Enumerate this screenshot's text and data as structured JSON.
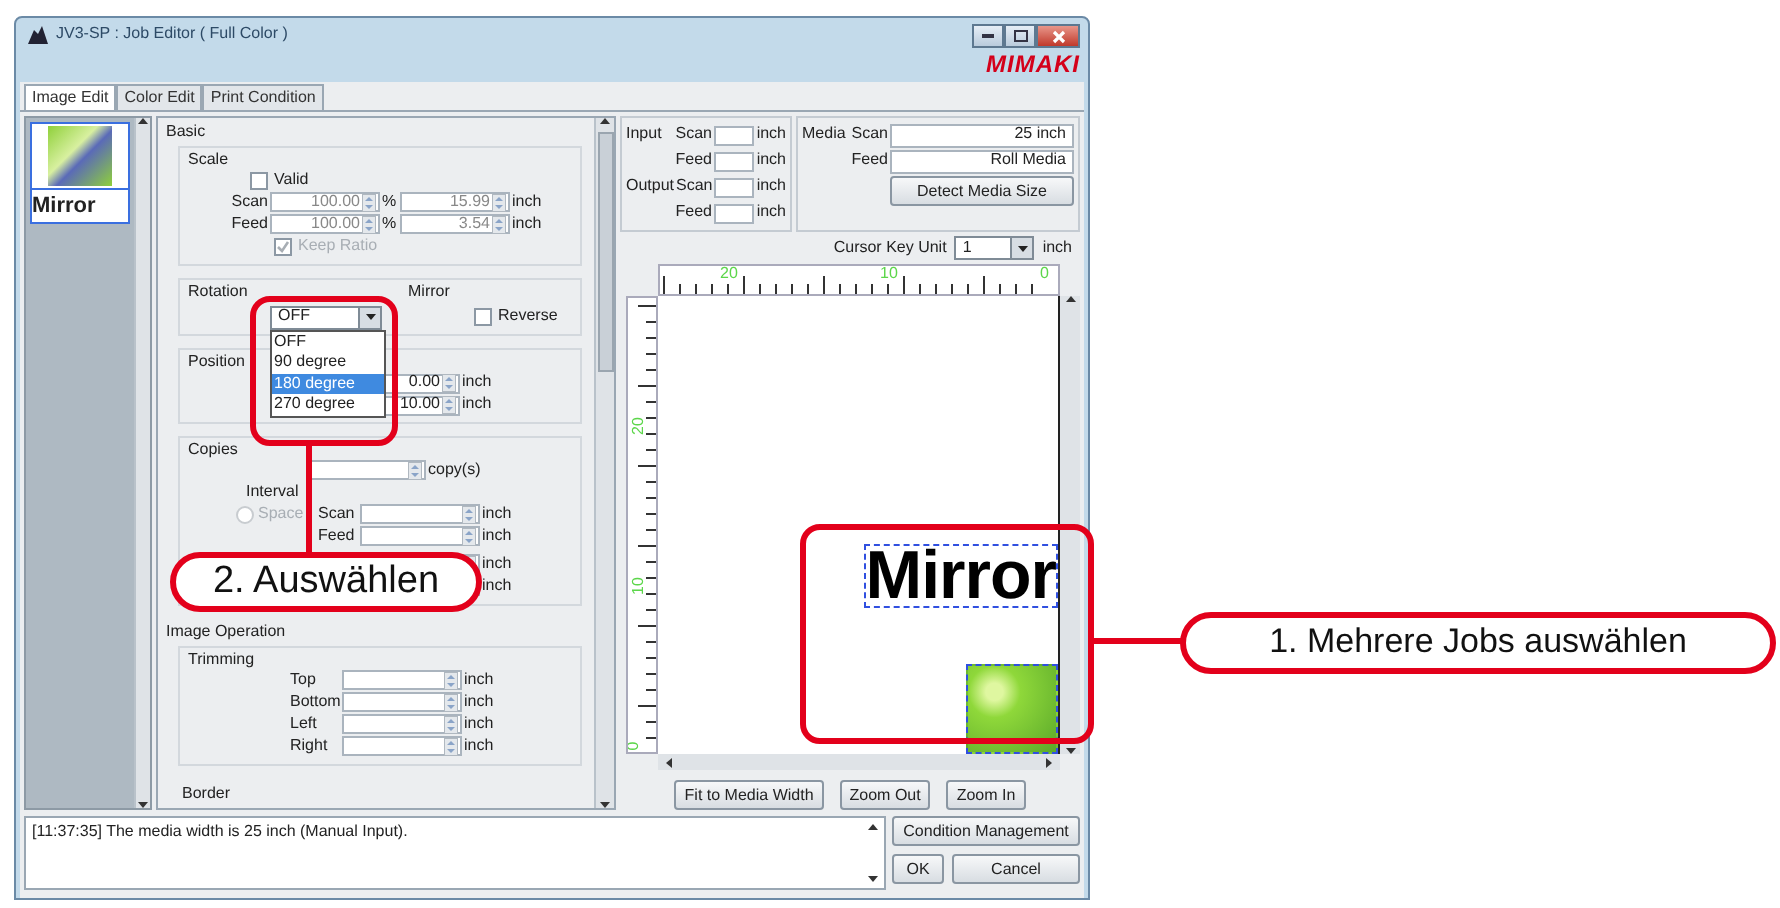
{
  "window": {
    "title": "JV3-SP : Job Editor ( Full Color )",
    "logo": "MIMAKI"
  },
  "tabs": [
    {
      "label": "Image Edit",
      "selected": true
    },
    {
      "label": "Color Edit",
      "selected": false
    },
    {
      "label": "Print Condition",
      "selected": false
    }
  ],
  "job_list": [
    {
      "caption": "Mirror",
      "selected": true
    }
  ],
  "basic": {
    "title": "Basic",
    "scale": {
      "title": "Scale",
      "valid": {
        "label": "Valid",
        "checked": false
      },
      "rows": [
        {
          "label": "Scan",
          "percent": "100.00",
          "percent_unit": "%",
          "length": "15.99",
          "unit": "inch"
        },
        {
          "label": "Feed",
          "percent": "100.00",
          "percent_unit": "%",
          "length": "3.54",
          "unit": "inch"
        }
      ],
      "keep_ratio": {
        "label": "Keep Ratio",
        "checked": true,
        "disabled": true
      }
    },
    "rotation": {
      "title": "Rotation",
      "value": "OFF",
      "options": [
        {
          "label": "OFF",
          "highlighted": false
        },
        {
          "label": "90 degree",
          "highlighted": false
        },
        {
          "label": "180 degree",
          "highlighted": true
        },
        {
          "label": "270 degree",
          "highlighted": false
        }
      ]
    },
    "mirror": {
      "title": "Mirror",
      "reverse": {
        "label": "Reverse",
        "checked": false
      }
    },
    "position": {
      "title": "Position",
      "rows": [
        {
          "value": "0.00",
          "unit": "inch"
        },
        {
          "value": "10.00",
          "unit": "inch"
        }
      ]
    },
    "copies": {
      "title": "Copies",
      "unit": "copy(s)",
      "interval": "Interval",
      "space": {
        "label": "Space",
        "selected": false,
        "disabled": true
      },
      "rows": [
        {
          "label": "Scan",
          "unit": "inch"
        },
        {
          "label": "Feed",
          "unit": "inch"
        },
        {
          "unit": "inch"
        },
        {
          "unit": "inch"
        }
      ]
    }
  },
  "image_operation": {
    "title": "Image Operation",
    "trimming": {
      "title": "Trimming",
      "rows": [
        {
          "label": "Top",
          "unit": "inch"
        },
        {
          "label": "Bottom",
          "unit": "inch"
        },
        {
          "label": "Left",
          "unit": "inch"
        },
        {
          "label": "Right",
          "unit": "inch"
        }
      ]
    },
    "border": {
      "title": "Border"
    }
  },
  "size_info": {
    "rows": [
      {
        "group": "Input",
        "label": "Scan",
        "unit": "inch"
      },
      {
        "label": "Feed",
        "unit": "inch"
      },
      {
        "group": "Output",
        "label": "Scan",
        "unit": "inch"
      },
      {
        "label": "Feed",
        "unit": "inch"
      }
    ]
  },
  "media": {
    "title": "Media",
    "rows": [
      {
        "label": "Scan",
        "value": "25 inch"
      },
      {
        "label": "Feed",
        "value": "Roll Media"
      }
    ],
    "button": "Detect Media Size"
  },
  "cursor_key_unit": {
    "label": "Cursor Key Unit",
    "value": "1",
    "unit": "inch"
  },
  "preview": {
    "top_ruler": [
      "20",
      "10",
      "0"
    ],
    "left_ruler": [
      "20",
      "10",
      "0"
    ],
    "objects": [
      {
        "kind": "text",
        "text": "Mirror"
      },
      {
        "kind": "image"
      }
    ]
  },
  "preview_buttons": [
    "Fit to Media Width",
    "Zoom Out",
    "Zoom In"
  ],
  "log": {
    "lines": [
      "[11:37:35] The media width is 25 inch (Manual Input)."
    ]
  },
  "buttons": [
    "Condition Management",
    "OK",
    "Cancel"
  ],
  "callouts": [
    {
      "text": "2. Auswählen"
    },
    {
      "text": "1. Mehrere Jobs auswählen"
    }
  ]
}
